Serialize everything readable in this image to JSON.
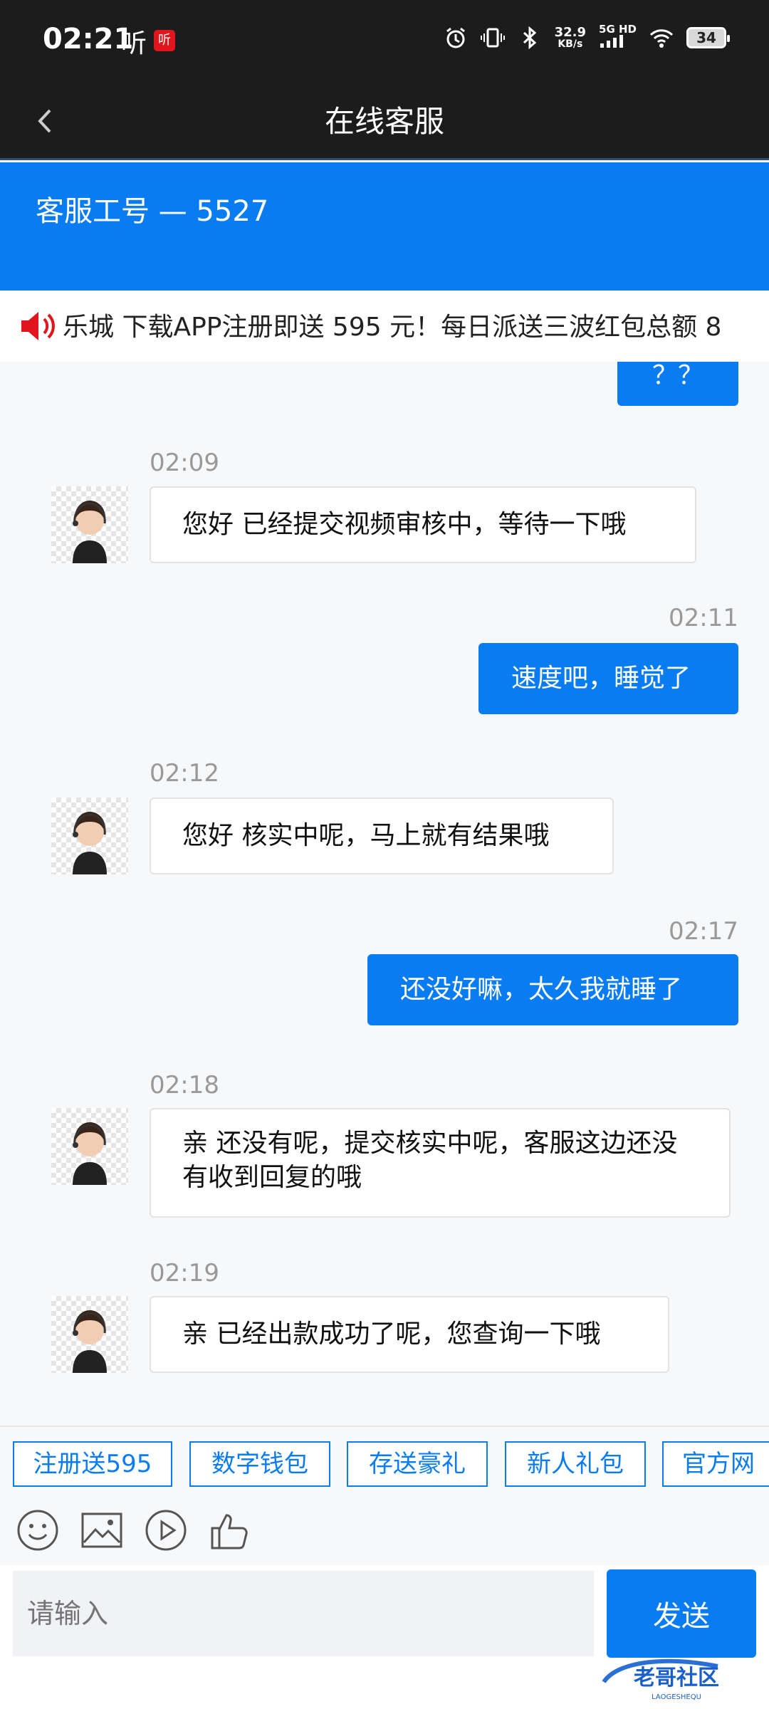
{
  "status_bar": {
    "time": "02:21",
    "ting_label": "听",
    "badge_label": "听",
    "net_speed": "32.9",
    "net_unit": "KB/s",
    "network": "5G HD",
    "battery": "34"
  },
  "titlebar": {
    "title": "在线客服"
  },
  "agent": {
    "id_label": "客服工号 — 5527"
  },
  "marquee": {
    "text": "乐城 下载APP注册即送 595 元！每日派送三波红包总额 8"
  },
  "messages": [
    {
      "type": "out",
      "text": "？？"
    },
    {
      "type": "in",
      "time": "02:09",
      "text": "您好 已经提交视频审核中，等待一下哦"
    },
    {
      "type": "out",
      "time": "02:11",
      "text": "速度吧，睡觉了"
    },
    {
      "type": "in",
      "time": "02:12",
      "text": "您好 核实中呢，马上就有结果哦"
    },
    {
      "type": "out",
      "time": "02:17",
      "text": "还没好嘛，太久我就睡了"
    },
    {
      "type": "in",
      "time": "02:18",
      "text": "亲 还没有呢，提交核实中呢，客服这边还没有收到回复的哦"
    },
    {
      "type": "in",
      "time": "02:19",
      "text": "亲 已经出款成功了呢，您查询一下哦"
    }
  ],
  "quick_tags": [
    "注册送595",
    "数字钱包",
    "存送豪礼",
    "新人礼包",
    "官方网"
  ],
  "input": {
    "placeholder": "请输入"
  },
  "send_label": "发送",
  "watermark_text": "老哥社区",
  "watermark_sub": "LAOGESHEQU",
  "colors": {
    "primary": "#0a7cf2",
    "dark_bar": "#1c1c1c"
  }
}
